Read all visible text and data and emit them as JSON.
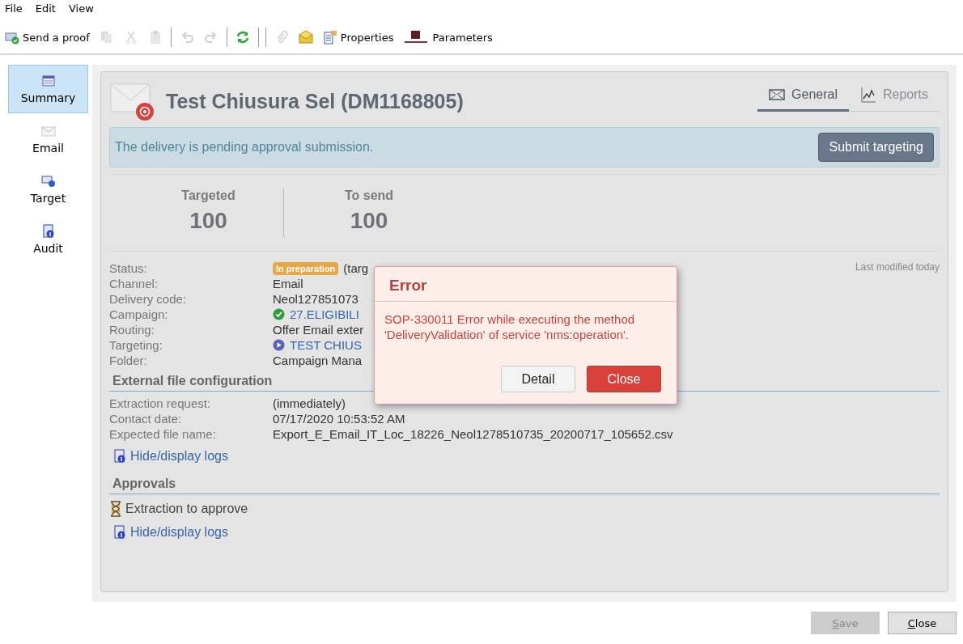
{
  "menu": [
    "File",
    "Edit",
    "View"
  ],
  "toolbar": [
    {
      "kind": "button",
      "label": "Send a proof",
      "disabled": false
    },
    {
      "kind": "icon",
      "disabled": true
    },
    {
      "kind": "icon",
      "disabled": true
    },
    {
      "kind": "icon",
      "disabled": true
    },
    {
      "kind": "separator"
    },
    {
      "kind": "icon",
      "disabled": true
    },
    {
      "kind": "icon",
      "disabled": true
    },
    {
      "kind": "separator"
    },
    {
      "kind": "icon",
      "disabled": false
    },
    {
      "kind": "separator"
    },
    {
      "kind": "separator"
    },
    {
      "kind": "icon",
      "disabled": true
    },
    {
      "kind": "icon",
      "disabled": false
    },
    {
      "kind": "button",
      "label": "Properties",
      "disabled": false
    },
    {
      "kind": "button",
      "label": "Parameters",
      "disabled": false
    }
  ],
  "sidebar": {
    "items": [
      {
        "label": "Summary",
        "selected": true
      },
      {
        "label": "Email",
        "selected": false
      },
      {
        "label": "Target",
        "selected": false
      },
      {
        "label": "Audit",
        "selected": false
      }
    ]
  },
  "title": "Test Chiusura Sel (DM1168805)",
  "tabs": [
    {
      "label": "General",
      "selected": true
    },
    {
      "label": "Reports",
      "selected": false
    }
  ],
  "banner": {
    "message": "The delivery is pending approval submission.",
    "button": "Submit targeting"
  },
  "counters": [
    {
      "label": "Targeted",
      "value": "100"
    },
    {
      "label": "To send",
      "value": "100"
    }
  ],
  "status": {
    "label": "Status:",
    "badge": "In preparation",
    "note": "(targ",
    "last_modified": "Last modified today"
  },
  "details": [
    {
      "label": "Channel:",
      "value": "Email",
      "kind": "text"
    },
    {
      "label": "Delivery code:",
      "value": "Neol127851073",
      "kind": "text"
    },
    {
      "label": "Campaign:",
      "value": "27.ELIGIBILI",
      "kind": "approved"
    },
    {
      "label": "Routing:",
      "value": "Offer Email exter",
      "kind": "text"
    },
    {
      "label": "Targeting:",
      "value": "TEST CHIUS",
      "kind": "workflow"
    },
    {
      "label": "Folder:",
      "value": "Campaign Mana",
      "kind": "text"
    }
  ],
  "external": {
    "title": "External file configuration",
    "rows": [
      {
        "label": "Extraction request:",
        "value": "(immediately)"
      },
      {
        "label": "Contact date:",
        "value": "07/17/2020 10:53:52 AM"
      },
      {
        "label": "Expected file name:",
        "value": "Export_E_Email_IT_Loc_18226_Neol1278510735_20200717_105652.csv"
      }
    ],
    "logs": "Hide/display logs"
  },
  "approvals": {
    "title": "Approvals",
    "item": "Extraction to approve",
    "logs": "Hide/display logs"
  },
  "dialog": {
    "title": "Error",
    "message": "SOP-330011 Error while executing the method 'DeliveryValidation' of service 'nms:operation'.",
    "buttons": [
      {
        "label": "Detail",
        "primary": false
      },
      {
        "label": "Close",
        "primary": true
      }
    ]
  },
  "footer": [
    {
      "label": "Save",
      "disabled": true
    },
    {
      "label": "Close",
      "disabled": false
    }
  ]
}
